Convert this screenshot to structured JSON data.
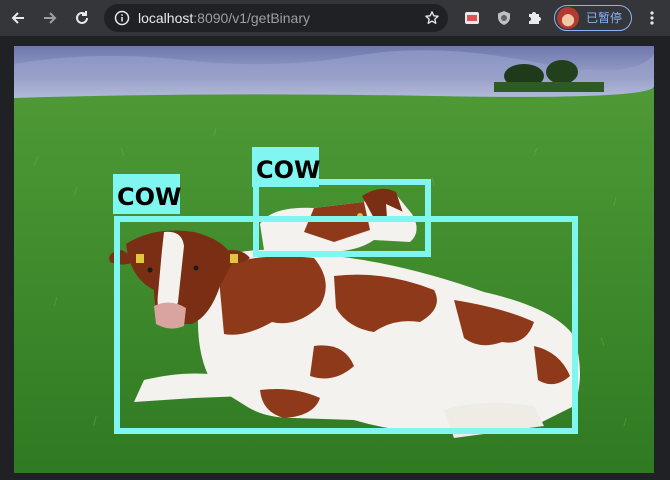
{
  "browser": {
    "url_host": "localhost",
    "url_rest": ":8090/v1/getBinary",
    "profile_label": "已暂停",
    "accent": "#8ab4f8",
    "icons": [
      "back-icon",
      "forward-icon",
      "reload-icon",
      "info-icon",
      "star-icon",
      "extension-icon",
      "shield-icon",
      "puzzle-icon",
      "kebab-menu-icon"
    ]
  },
  "detections": [
    {
      "label": "COW"
    },
    {
      "label": "COW"
    }
  ],
  "colors": {
    "box": "#7ff6f0",
    "label_text": "#000000",
    "grass": "#3d8a2a",
    "sky": "#8d96c4",
    "cow_brown": "#8e3a1a",
    "cow_white": "#f4f2ee"
  }
}
